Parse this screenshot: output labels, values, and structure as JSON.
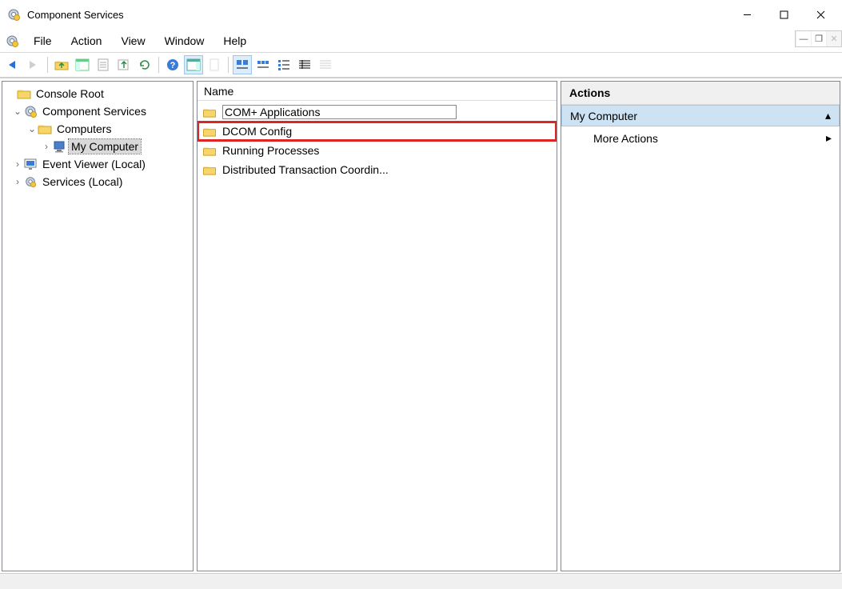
{
  "window": {
    "title": "Component Services"
  },
  "menu": {
    "file": "File",
    "action": "Action",
    "view": "View",
    "window": "Window",
    "help": "Help"
  },
  "toolbar_icons": [
    "back",
    "forward",
    "up",
    "show-hide-tree",
    "properties",
    "export-list",
    "refresh",
    "help",
    "show-hide-actions",
    "new",
    "sep",
    "view-large",
    "view-small",
    "view-list",
    "view-detail",
    "view-detail2"
  ],
  "tree": {
    "root": "Console Root",
    "cs": "Component Services",
    "computers": "Computers",
    "mycomputer": "My Computer",
    "ev": "Event Viewer (Local)",
    "svc": "Services (Local)"
  },
  "list": {
    "header": "Name",
    "items": [
      {
        "label": "COM+ Applications",
        "selected": true,
        "highlighted": false
      },
      {
        "label": "DCOM Config",
        "selected": false,
        "highlighted": true
      },
      {
        "label": "Running Processes",
        "selected": false,
        "highlighted": false
      },
      {
        "label": "Distributed Transaction Coordin...",
        "selected": false,
        "highlighted": false
      }
    ]
  },
  "actions": {
    "title": "Actions",
    "section": "My Computer",
    "more": "More Actions"
  }
}
